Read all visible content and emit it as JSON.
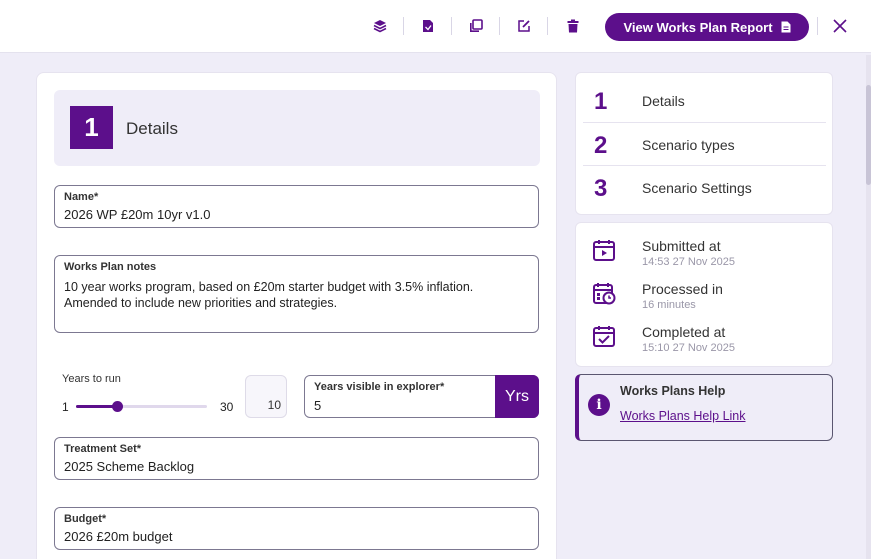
{
  "toolbar": {
    "icons": [
      "layers-icon",
      "document-icon",
      "copy-icon",
      "edit-icon",
      "delete-icon"
    ],
    "report_button_label": "View Works Plan Report",
    "accent_color": "#5c0f8b"
  },
  "section": {
    "number": "1",
    "title": "Details"
  },
  "form": {
    "name": {
      "label": "Name*",
      "value": "2026 WP £20m 10yr v1.0"
    },
    "notes": {
      "label": "Works Plan notes",
      "value": "10 year works program, based on £20m starter budget with 3.5% inflation. Amended to include new priorities and strategies."
    },
    "years_to_run": {
      "label": "Years to run",
      "min": "1",
      "max": "30",
      "value": "10",
      "slider_value": 10
    },
    "years_visible": {
      "label": "Years visible in explorer*",
      "value": "5",
      "unit": "Yrs"
    },
    "treatment_set": {
      "label": "Treatment Set*",
      "value": "2025 Scheme Backlog"
    },
    "budget": {
      "label": "Budget*",
      "value": "2026 £20m budget"
    }
  },
  "steps": [
    {
      "number": "1",
      "label": "Details"
    },
    {
      "number": "2",
      "label": "Scenario types"
    },
    {
      "number": "3",
      "label": "Scenario Settings"
    }
  ],
  "status": [
    {
      "title": "Submitted at",
      "value": "14:53 27 Nov 2025",
      "icon": "calendar-play-icon"
    },
    {
      "title": "Processed in",
      "value": "16 minutes",
      "icon": "calendar-clock-icon"
    },
    {
      "title": "Completed at",
      "value": "15:10 27 Nov 2025",
      "icon": "calendar-check-icon"
    }
  ],
  "help": {
    "title": "Works Plans Help",
    "link": "Works Plans Help Link",
    "icon": "info-icon"
  }
}
